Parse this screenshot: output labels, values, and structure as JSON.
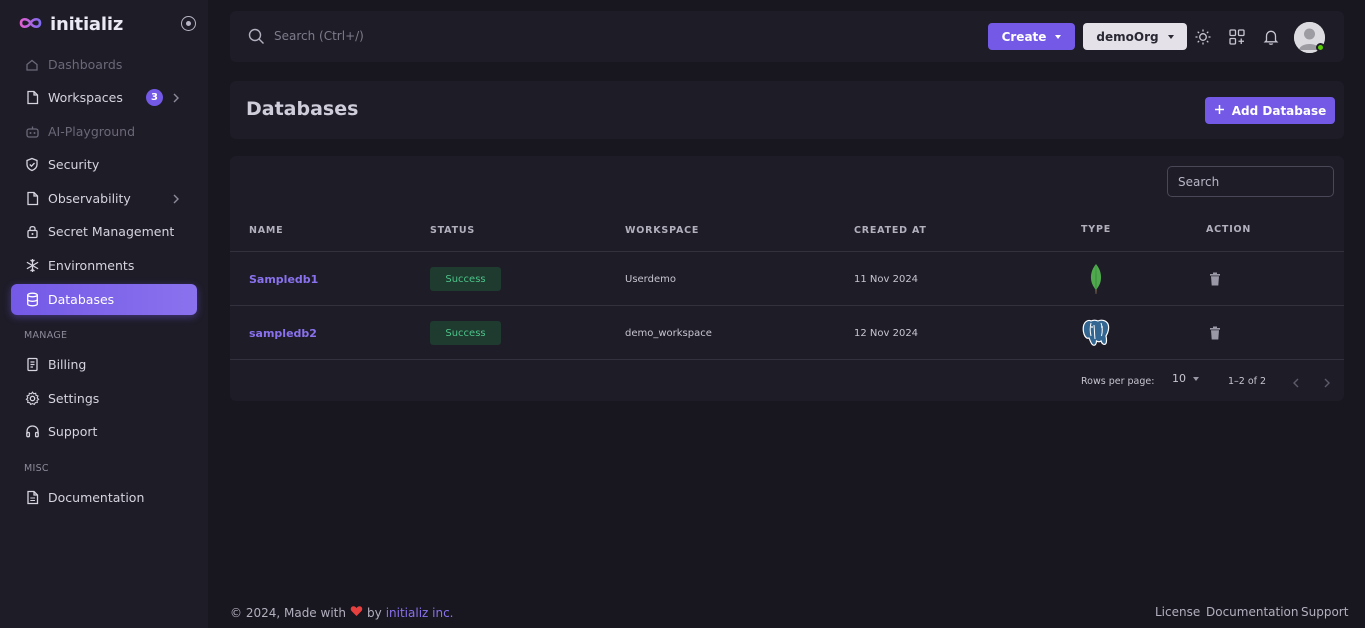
{
  "brand": {
    "name": "initializ"
  },
  "sidebar": {
    "items": [
      {
        "label": "Dashboards",
        "icon": "home-icon",
        "disabled": true
      },
      {
        "label": "Workspaces",
        "icon": "file-icon",
        "badge": "3"
      },
      {
        "label": "AI-Playground",
        "icon": "robot-icon",
        "disabled": true
      },
      {
        "label": "Security",
        "icon": "shield-icon"
      },
      {
        "label": "Observability",
        "icon": "file-icon"
      },
      {
        "label": "Secret Management",
        "icon": "lock-icon"
      },
      {
        "label": "Environments",
        "icon": "snowflake-icon"
      },
      {
        "label": "Databases",
        "icon": "database-icon",
        "active": true
      }
    ],
    "manage_label": "MANAGE",
    "manage_items": [
      {
        "label": "Billing",
        "icon": "receipt-icon"
      },
      {
        "label": "Settings",
        "icon": "gear-icon"
      },
      {
        "label": "Support",
        "icon": "headphones-icon"
      }
    ],
    "misc_label": "MISC",
    "misc_items": [
      {
        "label": "Documentation",
        "icon": "document-icon"
      }
    ]
  },
  "topbar": {
    "search_placeholder": "Search (Ctrl+/)",
    "create_label": "Create",
    "org_label": "demoOrg"
  },
  "page": {
    "title": "Databases",
    "add_label": "Add Database"
  },
  "table": {
    "search_placeholder": "Search",
    "headers": {
      "name": "NAME",
      "status": "STATUS",
      "workspace": "WORKSPACE",
      "created_at": "CREATED AT",
      "type": "TYPE",
      "action": "ACTION"
    },
    "rows": [
      {
        "name": "Sampledb1",
        "status": "Success",
        "workspace": "Userdemo",
        "created_at": "11 Nov 2024",
        "type_icon": "mongodb-icon"
      },
      {
        "name": "sampledb2",
        "status": "Success",
        "workspace": "demo_workspace",
        "created_at": "12 Nov 2024",
        "type_icon": "postgresql-icon"
      }
    ],
    "pagination": {
      "rows_per_page_label": "Rows per page:",
      "rows_per_page": "10",
      "range": "1–2 of 2"
    }
  },
  "footer": {
    "copyright": "© 2024, Made with",
    "by": "by",
    "company": "initializ inc.",
    "links": [
      "License",
      "Documentation",
      "Support"
    ]
  },
  "colors": {
    "accent": "#7359e6",
    "background": "#18161f",
    "surface": "#1e1c27",
    "success": "#4cc38a"
  }
}
